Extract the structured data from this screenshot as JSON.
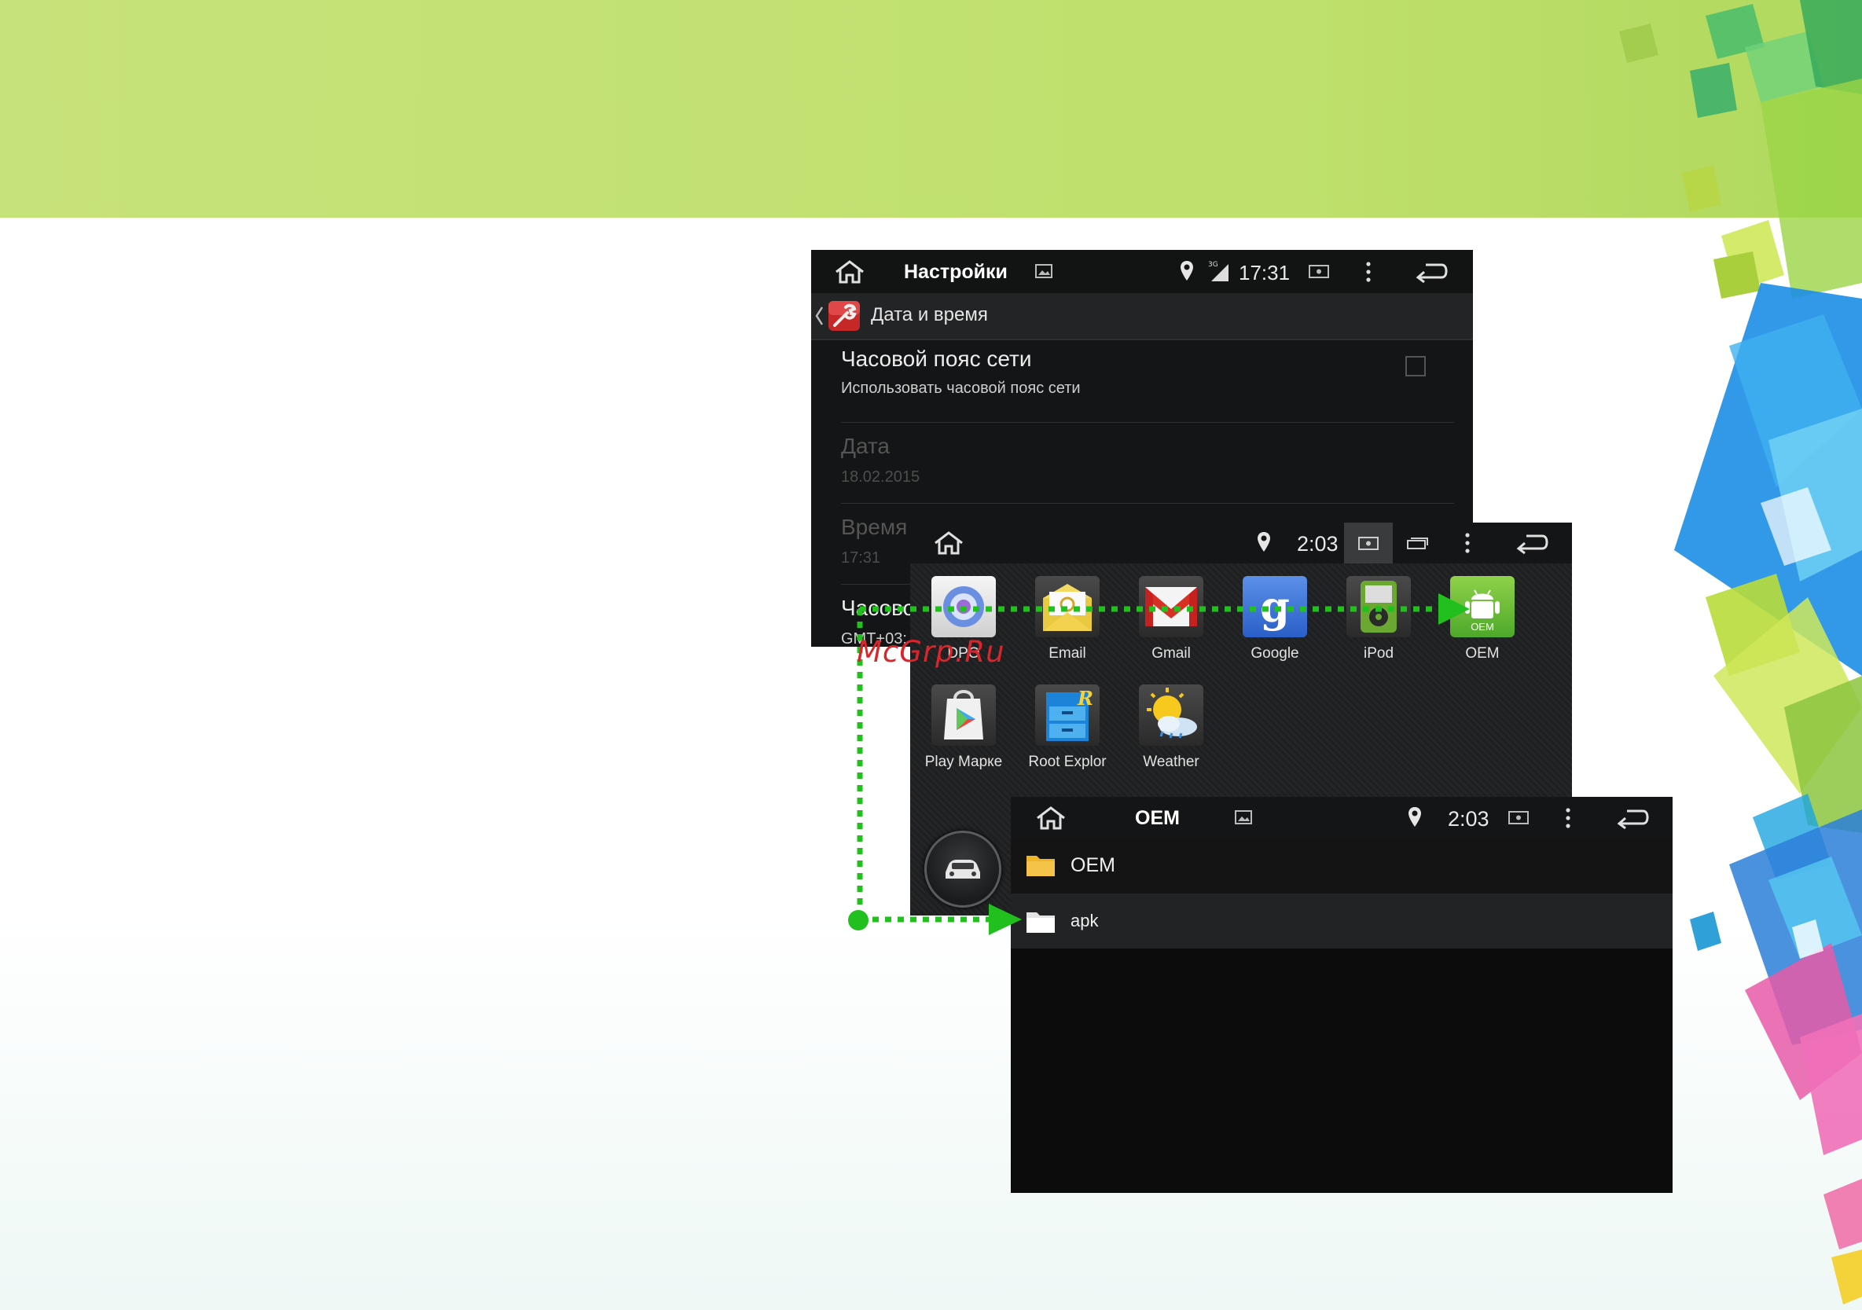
{
  "screen1": {
    "title": "Настройки",
    "clock": "17:31",
    "section_title": "Дата и время",
    "rows": [
      {
        "title": "Часовой пояс сети",
        "subtitle": "Использовать часовой пояс сети",
        "enabled": true
      },
      {
        "title": "Дата",
        "subtitle": "18.02.2015",
        "enabled": false
      },
      {
        "title": "Время",
        "subtitle": "17:31",
        "enabled": false
      },
      {
        "title": "Часово",
        "subtitle": "GMT+03:",
        "enabled": true
      }
    ]
  },
  "screen2": {
    "clock": "2:03",
    "apps": [
      {
        "label": "DPO",
        "icon": "dpo-icon"
      },
      {
        "label": "Email",
        "icon": "email-icon"
      },
      {
        "label": "Gmail",
        "icon": "gmail-icon"
      },
      {
        "label": "Google",
        "icon": "google-icon"
      },
      {
        "label": "iPod",
        "icon": "ipod-icon"
      },
      {
        "label": "OEM",
        "icon": "oem-android-icon",
        "badge": "OEM"
      },
      {
        "label": "Play Марке",
        "icon": "play-market-icon"
      },
      {
        "label": "Root Explor",
        "icon": "root-explorer-icon"
      },
      {
        "label": "Weather",
        "icon": "weather-icon"
      }
    ]
  },
  "screen3": {
    "title": "OEM",
    "clock": "2:03",
    "folders": [
      {
        "label": "OEM",
        "color": "#f0b429"
      },
      {
        "label": "apk",
        "color": "#ffffff"
      }
    ]
  },
  "watermark": "McGrp.Ru",
  "colors": {
    "arrow": "#22c01e",
    "band": "#c3e175"
  }
}
